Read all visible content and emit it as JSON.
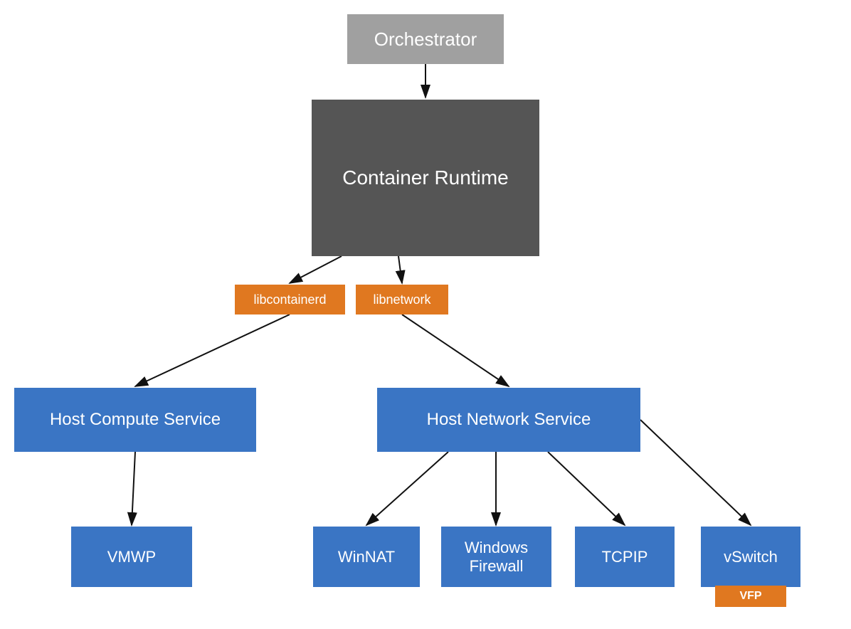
{
  "nodes": {
    "orchestrator": {
      "label": "Orchestrator"
    },
    "runtime": {
      "label": "Container Runtime"
    },
    "libcontainerd": {
      "label": "libcontainerd"
    },
    "libnetwork": {
      "label": "libnetwork"
    },
    "hcs": {
      "label": "Host Compute Service"
    },
    "hns": {
      "label": "Host Network Service"
    },
    "vmwp": {
      "label": "VMWP"
    },
    "winnat": {
      "label": "WinNAT"
    },
    "windows_firewall": {
      "label": "Windows Firewall"
    },
    "tcpip": {
      "label": "TCPIP"
    },
    "vswitch": {
      "label": "vSwitch"
    },
    "vfp": {
      "label": "VFP"
    }
  }
}
